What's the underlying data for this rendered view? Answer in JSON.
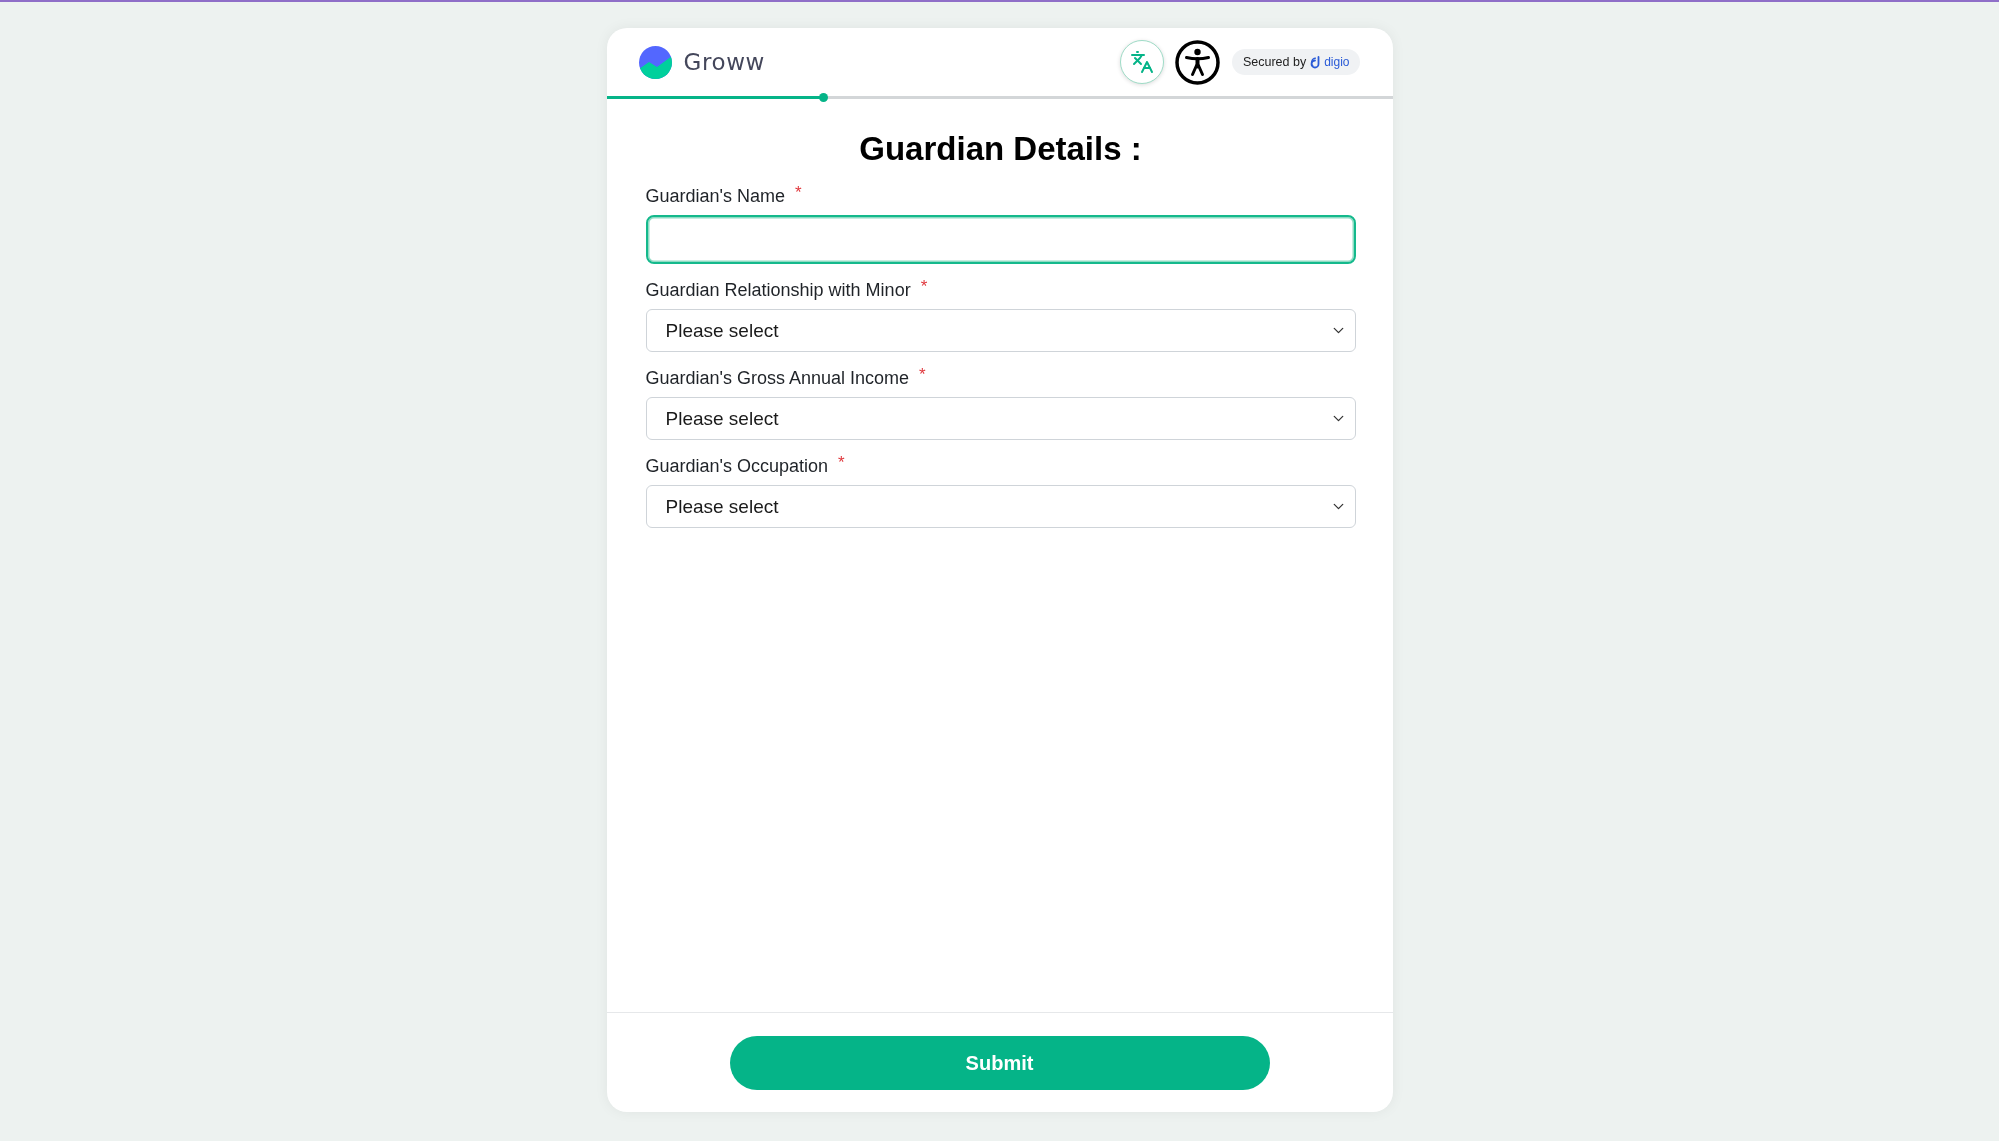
{
  "header": {
    "brand": "Groww",
    "badge": {
      "prefix": "Secured by",
      "brand": "digio"
    }
  },
  "progress": {
    "level": 0.276
  },
  "title": "Guardian Details :",
  "fields": [
    {
      "kind": "text",
      "label": "Guardian's Name",
      "required_mark": "*",
      "focused": true
    },
    {
      "kind": "select",
      "label": "Guardian Relationship with Minor",
      "required_mark": "*",
      "value": "Please select",
      "focused": false
    },
    {
      "kind": "select",
      "label": "Guardian's Gross Annual Income",
      "required_mark": "*",
      "value": "Please select",
      "focused": false
    },
    {
      "kind": "select",
      "label": "Guardian's Occupation",
      "required_mark": "*",
      "value": "Please select",
      "focused": false
    }
  ],
  "submit_button": {
    "label": "Submit"
  }
}
